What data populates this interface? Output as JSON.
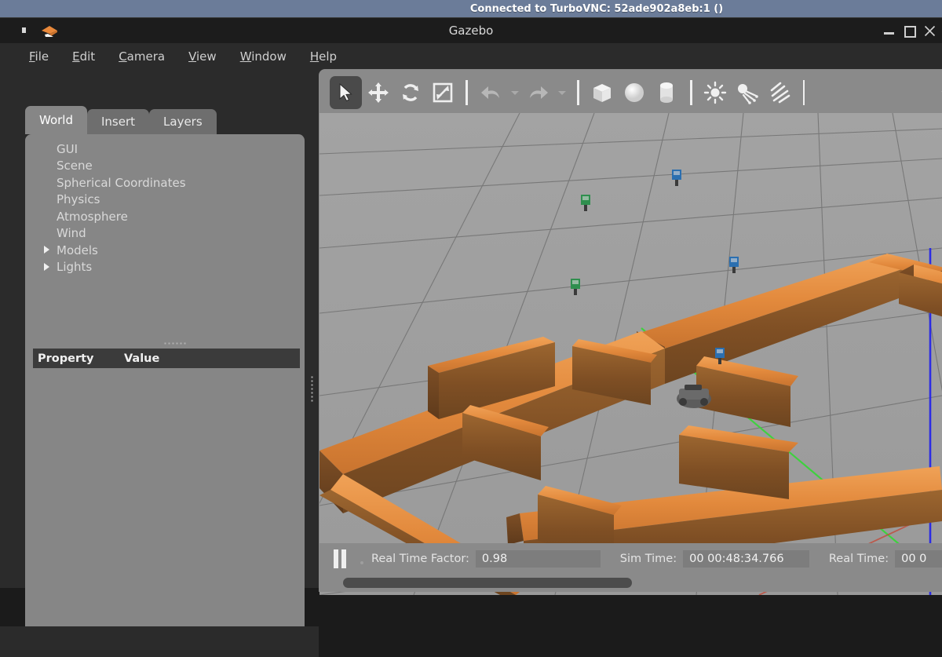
{
  "vnc": {
    "banner": "Connected to TurboVNC: 52ade902a8eb:1 ()"
  },
  "window": {
    "title": "Gazebo",
    "logo_icon": "gazebo-logo-icon",
    "controls": [
      {
        "name": "minimize-button",
        "icon": "minimize-icon",
        "label": "Minimize"
      },
      {
        "name": "maximize-button",
        "icon": "maximize-icon",
        "label": "Maximize"
      },
      {
        "name": "close-button",
        "icon": "close-icon",
        "label": "Close"
      }
    ]
  },
  "menubar": {
    "items": [
      {
        "label": "File",
        "accel": "F"
      },
      {
        "label": "Edit",
        "accel": "E"
      },
      {
        "label": "Camera",
        "accel": "C"
      },
      {
        "label": "View",
        "accel": "V"
      },
      {
        "label": "Window",
        "accel": "W"
      },
      {
        "label": "Help",
        "accel": "H"
      }
    ]
  },
  "left_panel": {
    "tabs": [
      {
        "label": "World",
        "active": true
      },
      {
        "label": "Insert",
        "active": false
      },
      {
        "label": "Layers",
        "active": false
      }
    ],
    "tree": [
      {
        "label": "GUI",
        "expandable": false
      },
      {
        "label": "Scene",
        "expandable": false
      },
      {
        "label": "Spherical Coordinates",
        "expandable": false
      },
      {
        "label": "Physics",
        "expandable": false
      },
      {
        "label": "Atmosphere",
        "expandable": false
      },
      {
        "label": "Wind",
        "expandable": false
      },
      {
        "label": "Models",
        "expandable": true
      },
      {
        "label": "Lights",
        "expandable": true
      }
    ],
    "property_table": {
      "columns": [
        "Property",
        "Value"
      ],
      "rows": []
    }
  },
  "render_toolbar": {
    "buttons": [
      {
        "name": "select-mode-button",
        "icon": "arrow-cursor-icon",
        "active": true,
        "enabled": true
      },
      {
        "name": "translate-mode-button",
        "icon": "move-arrows-icon",
        "active": false,
        "enabled": true
      },
      {
        "name": "rotate-mode-button",
        "icon": "rotate-arrows-icon",
        "active": false,
        "enabled": true
      },
      {
        "name": "scale-mode-button",
        "icon": "scale-diagonal-icon",
        "active": false,
        "enabled": true
      },
      {
        "name": "undo-button",
        "icon": "undo-arrow-icon",
        "active": false,
        "enabled": false
      },
      {
        "name": "undo-history-dropdown",
        "icon": "chevron-down-icon",
        "active": false,
        "enabled": false
      },
      {
        "name": "redo-button",
        "icon": "redo-arrow-icon",
        "active": false,
        "enabled": false
      },
      {
        "name": "redo-history-dropdown",
        "icon": "chevron-down-icon",
        "active": false,
        "enabled": false
      },
      {
        "name": "insert-box-button",
        "icon": "cube-icon",
        "active": false,
        "enabled": true
      },
      {
        "name": "insert-sphere-button",
        "icon": "sphere-icon",
        "active": false,
        "enabled": true
      },
      {
        "name": "insert-cylinder-button",
        "icon": "cylinder-icon",
        "active": false,
        "enabled": true
      },
      {
        "name": "point-light-button",
        "icon": "point-light-sun-icon",
        "active": false,
        "enabled": true
      },
      {
        "name": "spot-light-button",
        "icon": "spot-light-icon",
        "active": false,
        "enabled": true
      },
      {
        "name": "directional-light-button",
        "icon": "directional-light-icon",
        "active": false,
        "enabled": true
      },
      {
        "name": "toolbar-overflow-button",
        "icon": "chevron-down-icon",
        "active": false,
        "enabled": true
      }
    ]
  },
  "scene": {
    "description": "Gazebo 3D viewport: wooden maze walls on a gray tiled ground plane with world axes",
    "ground_color": "#9b9b9b",
    "grid_line_color": "#6d6d6d",
    "wall_top_color": "#e8913f",
    "wall_face_color": "#8a5a2b",
    "axis_colors": {
      "x": "#c0392b",
      "y": "#2ecc40",
      "z": "#2030e0"
    },
    "robot": {
      "name": "ground-robot",
      "color": "#5a5a5a"
    },
    "markers": [
      {
        "name": "marker-green",
        "color": "#2f8f4e"
      },
      {
        "name": "marker-blue",
        "color": "#2b6fb0"
      }
    ]
  },
  "statusbar": {
    "pause_button": {
      "name": "pause-button",
      "icon": "pause-icon"
    },
    "real_time_factor_label": "Real Time Factor:",
    "real_time_factor_value": "0.98",
    "sim_time_label": "Sim Time:",
    "sim_time_value": "00 00:48:34.766",
    "real_time_label": "Real Time:",
    "real_time_value": "00 0"
  }
}
